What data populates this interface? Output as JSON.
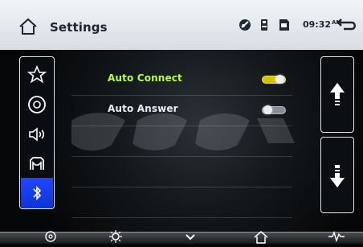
{
  "header": {
    "title": "Settings",
    "time": "09:32",
    "ampm": "AM"
  },
  "settings": [
    {
      "label": "Auto Connect",
      "state": "on",
      "color": "#b7ff44"
    },
    {
      "label": "Auto Answer",
      "state": "off",
      "color": "#ffffff"
    }
  ],
  "left_nav": {
    "items": [
      {
        "name": "favorites",
        "icon": "star-icon"
      },
      {
        "name": "disc",
        "icon": "disc-icon"
      },
      {
        "name": "audio",
        "icon": "speaker-icon"
      },
      {
        "name": "vehicle",
        "icon": "car-outline-icon"
      },
      {
        "name": "bluetooth",
        "icon": "bluetooth-icon",
        "active": true
      }
    ]
  },
  "status_icons": [
    "navigation-disc-icon",
    "usb-icon",
    "sd-card-icon"
  ],
  "bottom_nav": [
    "settings-gear-icon",
    "brightness-icon",
    "chevron-down-icon",
    "home-icon",
    "waveform-icon"
  ],
  "colors": {
    "accent_blue": "#0a36d6",
    "toggle_on": "#d4c400",
    "label_active": "#b7ff44"
  }
}
